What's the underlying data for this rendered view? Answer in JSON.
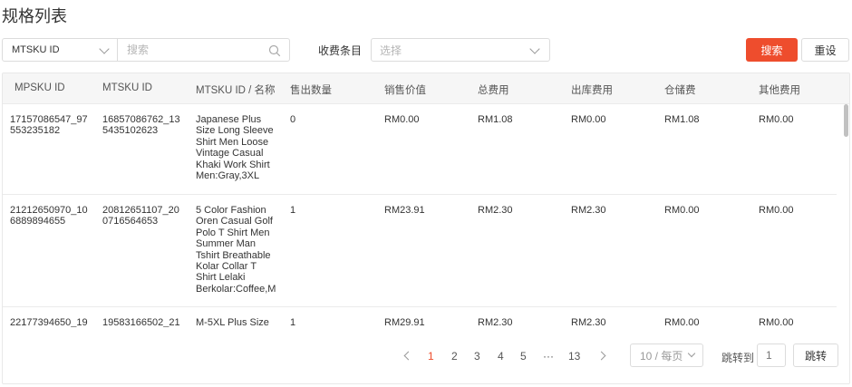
{
  "title": "规格列表",
  "filters": {
    "sku_type": "MTSKU ID",
    "search_placeholder": "搜索",
    "fee_label": "收费条目",
    "fee_placeholder": "选择",
    "search_button": "搜索",
    "reset_button": "重设"
  },
  "table": {
    "columns": [
      "MPSKU ID",
      "MTSKU ID",
      "MTSKU ID / 名称",
      "售出数量",
      "销售价值",
      "总费用",
      "出库费用",
      "仓储费",
      "其他费用"
    ],
    "rows": [
      {
        "mpsku": "17157086547_97553235182",
        "mtsku": "16857086762_135435102623",
        "name": "Japanese Plus Size Long Sleeve Shirt Men Loose Vintage Casual Khaki Work Shirt Men:Gray,3XL",
        "qty": "0",
        "sales": "RM0.00",
        "total": "RM1.08",
        "outbound": "RM0.00",
        "storage": "RM1.08",
        "other": "RM0.00"
      },
      {
        "mpsku": "21212650970_106889894655",
        "mtsku": "20812651107_200716564653",
        "name": "5 Color Fashion Oren Casual Golf Polo T Shirt Men Summer Man Tshirt Breathable Kolar Collar T Shirt Lelaki Berkolar:Coffee,M",
        "qty": "1",
        "sales": "RM23.91",
        "total": "RM2.30",
        "outbound": "RM2.30",
        "storage": "RM0.00",
        "other": "RM0.00"
      },
      {
        "mpsku": "22177394650_19",
        "mtsku": "19583166502_21",
        "name": "M-5XL Plus Size",
        "qty": "1",
        "sales": "RM29.91",
        "total": "RM2.30",
        "outbound": "RM2.30",
        "storage": "RM0.00",
        "other": "RM0.00"
      }
    ]
  },
  "pagination": {
    "pages": [
      "1",
      "2",
      "3",
      "4",
      "5",
      "···",
      "13"
    ],
    "active": "1",
    "per_page": "10 / 每页",
    "jump_label": "跳转到",
    "jump_placeholder": "1",
    "jump_button": "跳转"
  },
  "colors": {
    "accent": "#ee4d2d"
  }
}
